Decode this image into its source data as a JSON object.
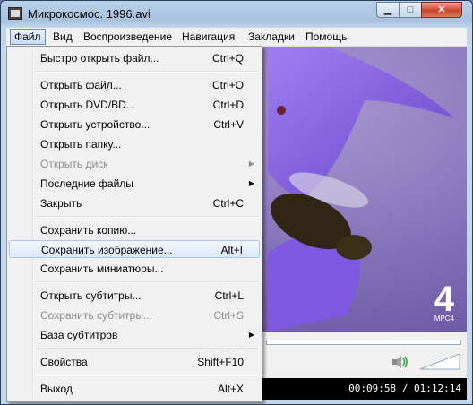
{
  "window": {
    "title": "Микрокосмос. 1996.avi",
    "minimize_glyph": "▁",
    "maximize_glyph": "□",
    "close_glyph": "✕"
  },
  "menubar": {
    "file": "Файл",
    "view": "Вид",
    "playback": "Воспроизведение",
    "navigation": "Навигация",
    "bookmarks": "Закладки",
    "help": "Помощь"
  },
  "file_menu": {
    "quick_open": {
      "label": "Быстро открыть файл...",
      "shortcut": "Ctrl+Q"
    },
    "open_file": {
      "label": "Открыть файл...",
      "shortcut": "Ctrl+O"
    },
    "open_dvd": {
      "label": "Открыть DVD/BD...",
      "shortcut": "Ctrl+D"
    },
    "open_device": {
      "label": "Открыть устройство...",
      "shortcut": "Ctrl+V"
    },
    "open_folder": {
      "label": "Открыть папку..."
    },
    "open_disc": {
      "label": "Открыть диск"
    },
    "recent_files": {
      "label": "Последние файлы"
    },
    "close": {
      "label": "Закрыть",
      "shortcut": "Ctrl+C"
    },
    "save_copy": {
      "label": "Сохранить копию..."
    },
    "save_image": {
      "label": "Сохранить изображение...",
      "shortcut": "Alt+I"
    },
    "save_thumbnails": {
      "label": "Сохранить миниатюры..."
    },
    "open_subtitles": {
      "label": "Открыть субтитры...",
      "shortcut": "Ctrl+L"
    },
    "save_subtitles": {
      "label": "Сохранить субтитры...",
      "shortcut": "Ctrl+S"
    },
    "subtitle_db": {
      "label": "База субтитров"
    },
    "properties": {
      "label": "Свойства",
      "shortcut": "Shift+F10"
    },
    "exit": {
      "label": "Выход",
      "shortcut": "Alt+X"
    }
  },
  "video": {
    "channel_logo": "МРС4",
    "channel_digit": "4"
  },
  "status": {
    "time": "00:09:58 / 01:12:14"
  },
  "icons": {
    "app": "film-icon",
    "speaker": "speaker-icon",
    "submenu": "triangle-right-icon"
  },
  "colors": {
    "highlight": "#dde9f8",
    "disabled_text": "#8d8d8d"
  }
}
